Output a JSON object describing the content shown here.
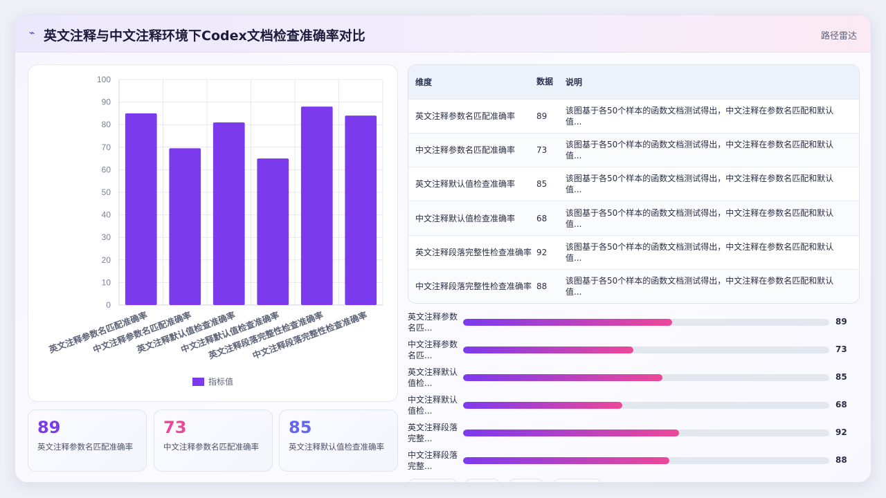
{
  "header": {
    "title": "英文注释与中文注释环境下Codex文档检查准确率对比",
    "route": "路径雷达",
    "logo_icon": "spark-icon"
  },
  "chart_data": {
    "type": "bar",
    "categories": [
      "英文注释参数名匹配准确率",
      "中文注释参数名匹配准确率",
      "英文注释默认值检查准确率",
      "中文注释默认值检查准确率",
      "英文注释段落完整性检查准确率",
      "中文注释段落完整性检查准确率"
    ],
    "series": [
      {
        "name": "指标值",
        "values": [
          85,
          69.5,
          81,
          65,
          88,
          84
        ]
      }
    ],
    "ylim": [
      0,
      100
    ],
    "yticks": [
      0,
      10,
      20,
      30,
      40,
      50,
      60,
      70,
      80,
      90,
      100
    ],
    "legend": "bottom",
    "grid": true,
    "color": "#7c3aed"
  },
  "kpis": [
    {
      "value": "89",
      "label": "英文注释参数名匹配准确率",
      "color": "#7c3aed"
    },
    {
      "value": "73",
      "label": "中文注释参数名匹配准确率",
      "color": "#ec4899"
    },
    {
      "value": "85",
      "label": "英文注释默认值检查准确率",
      "color": "#6366f1"
    }
  ],
  "table": {
    "headers": [
      "维度",
      "数据",
      "说明"
    ],
    "rows": [
      [
        "英文注释参数名匹配准确率",
        "89",
        "该图基于各50个样本的函数文档测试得出，中文注释在参数名匹配和默认值..."
      ],
      [
        "中文注释参数名匹配准确率",
        "73",
        "该图基于各50个样本的函数文档测试得出，中文注释在参数名匹配和默认值..."
      ],
      [
        "英文注释默认值检查准确率",
        "85",
        "该图基于各50个样本的函数文档测试得出，中文注释在参数名匹配和默认值..."
      ],
      [
        "中文注释默认值检查准确率",
        "68",
        "该图基于各50个样本的函数文档测试得出，中文注释在参数名匹配和默认值..."
      ],
      [
        "英文注释段落完整性检查准确率",
        "92",
        "该图基于各50个样本的函数文档测试得出，中文注释在参数名匹配和默认值..."
      ],
      [
        "中文注释段落完整性检查准确率",
        "88",
        "该图基于各50个样本的函数文档测试得出，中文注释在参数名匹配和默认值..."
      ]
    ]
  },
  "progress": [
    {
      "label": "英文注释参数名匹...",
      "value": "89",
      "fraction": 0.57
    },
    {
      "label": "中文注释参数名匹...",
      "value": "73",
      "fraction": 0.465
    },
    {
      "label": "英文注释默认值检...",
      "value": "85",
      "fraction": 0.544
    },
    {
      "label": "中文注释默认值检...",
      "value": "68",
      "fraction": 0.435
    },
    {
      "label": "英文注释段落完整...",
      "value": "92",
      "fraction": 0.589
    },
    {
      "label": "中文注释段落完整...",
      "value": "88",
      "fraction": 0.563
    }
  ]
}
